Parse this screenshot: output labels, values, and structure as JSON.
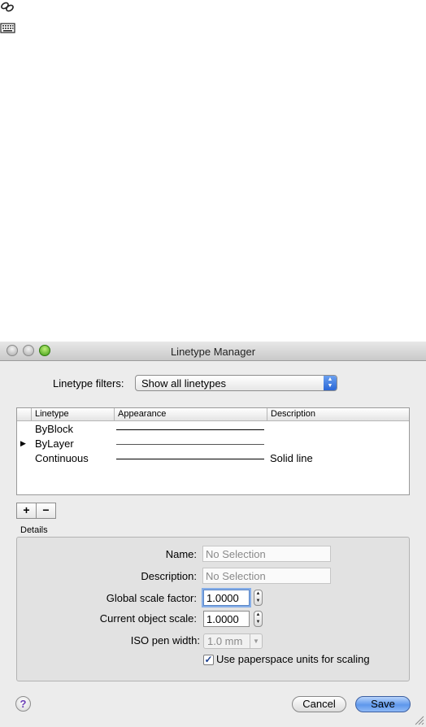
{
  "desktop": {
    "icons": [
      "link-tool-icon",
      "keyboard-icon"
    ]
  },
  "dialog": {
    "title": "Linetype Manager",
    "filters": {
      "label": "Linetype filters:",
      "selected": "Show all linetypes"
    },
    "table": {
      "columns": [
        "Linetype",
        "Appearance",
        "Description"
      ],
      "rows": [
        {
          "name": "ByBlock",
          "description": ""
        },
        {
          "name": "ByLayer",
          "description": ""
        },
        {
          "name": "Continuous",
          "description": "Solid line"
        }
      ]
    },
    "buttons": {
      "add": "+",
      "remove": "−",
      "help": "?",
      "cancel": "Cancel",
      "save": "Save"
    },
    "details": {
      "section_label": "Details",
      "name_label": "Name:",
      "name_value": "No Selection",
      "description_label": "Description:",
      "description_value": "No Selection",
      "global_scale_label": "Global scale factor:",
      "global_scale_value": "1.0000",
      "object_scale_label": "Current object scale:",
      "object_scale_value": "1.0000",
      "iso_pen_label": "ISO pen width:",
      "iso_pen_value": "1.0 mm",
      "paperspace_label": "Use paperspace units for scaling",
      "paperspace_checked": true
    }
  },
  "colors": {
    "save_button": "#5e98ec",
    "zoom_button": "#3d9a12",
    "help_glyph": "#6b3fb6"
  }
}
